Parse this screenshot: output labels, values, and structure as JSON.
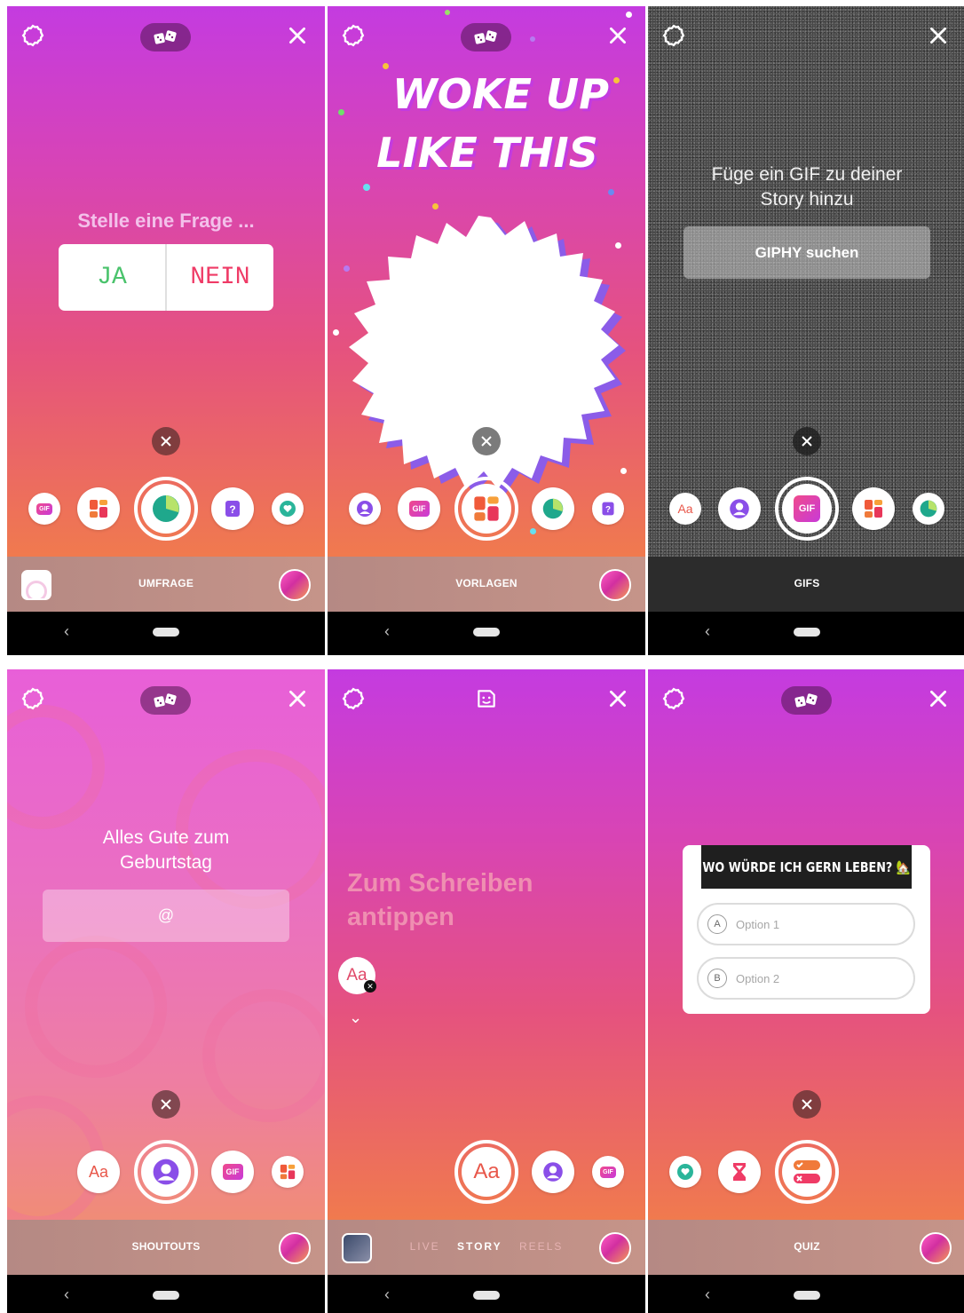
{
  "panels": [
    {
      "mode_label": "UMFRAGE",
      "poll": {
        "question": "Stelle eine Frage ...",
        "option_yes": "JA",
        "option_no": "NEIN"
      },
      "tray": [
        "gif-sticker",
        "templates-sticker",
        "poll-sticker",
        "question-sticker",
        "support-sticker"
      ]
    },
    {
      "mode_label": "VORLAGEN",
      "template": {
        "line1": "WOKE UP",
        "line2": "LIKE THIS"
      },
      "tray": [
        "shoutout-sticker",
        "gif-sticker",
        "templates-sticker",
        "poll-sticker",
        "question-sticker"
      ]
    },
    {
      "mode_label": "GIFS",
      "gif": {
        "title_line1": "Füge ein GIF zu deiner",
        "title_line2": "Story hinzu",
        "button": "GIPHY suchen"
      },
      "tray_text_label": "Aa",
      "tray_gif_label": "GIF"
    },
    {
      "mode_label": "SHOUTOUTS",
      "shoutout": {
        "title_line1": "Alles Gute zum",
        "title_line2": "Geburtstag",
        "placeholder": "@"
      },
      "tray_text_label": "Aa",
      "tray_gif_label": "GIF"
    },
    {
      "text_mode": {
        "line1": "Zum Schreiben",
        "line2": "antippen",
        "chip": "Aa"
      },
      "capture_modes": {
        "live": "LIVE",
        "story": "STORY",
        "reels": "REELS",
        "selected": "STORY"
      },
      "tray_text_label": "Aa",
      "tray_gif_label": "GIF"
    },
    {
      "mode_label": "QUIZ",
      "quiz": {
        "title": "WO WÜRDE ICH GERN LEBEN? 🏡",
        "options": [
          {
            "letter": "A",
            "label": "Option 1"
          },
          {
            "letter": "B",
            "label": "Option 2"
          }
        ]
      }
    }
  ],
  "colors": {
    "gradient_top": "#c43be0",
    "gradient_bottom": "#f07a4e",
    "poll_yes": "#4ac36c",
    "poll_no": "#ef3b66"
  }
}
